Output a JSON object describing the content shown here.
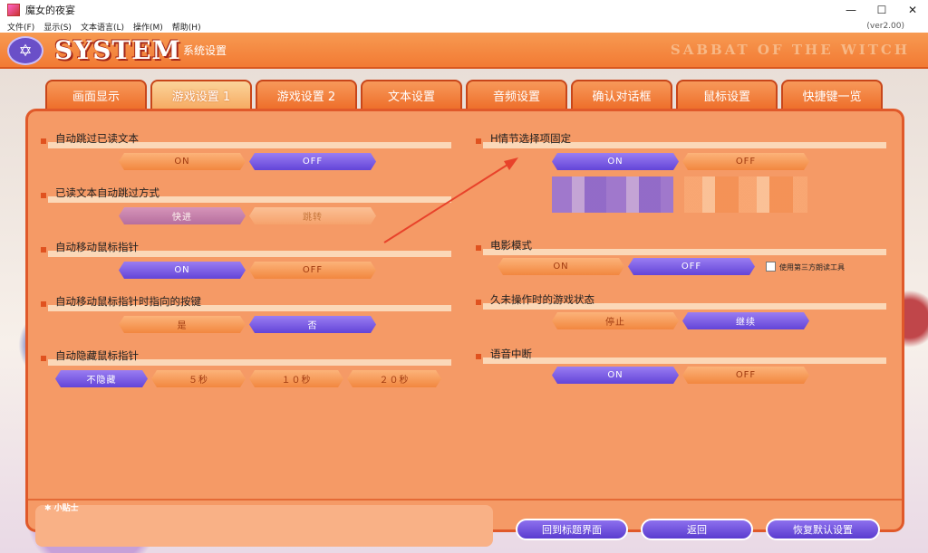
{
  "window": {
    "title": "魔女的夜宴",
    "minimize": "—",
    "maximize": "☐",
    "close": "✕"
  },
  "menu": {
    "items": [
      "文件(F)",
      "显示(S)",
      "文本语言(L)",
      "操作(M)",
      "帮助(H)"
    ],
    "version": "(ver2.00)"
  },
  "header": {
    "logo": "SYSTEM",
    "subtitle": "系统设置",
    "brand": "SABBAT OF THE WITCH"
  },
  "tabs": [
    "画面显示",
    "游戏设置 1",
    "游戏设置 2",
    "文本设置",
    "音频设置",
    "确认对话框",
    "鼠标设置",
    "快捷键一览"
  ],
  "active_tab": "游戏设置 1",
  "left": {
    "s1": {
      "label": "自动跳过已读文本",
      "a": "ON",
      "b": "OFF"
    },
    "s2": {
      "label": "已读文本自动跳过方式",
      "a": "快进",
      "b": "跳转"
    },
    "s3": {
      "label": "自动移动鼠标指针",
      "a": "ON",
      "b": "OFF"
    },
    "s4": {
      "label": "自动移动鼠标指针时指向的按键",
      "a": "是",
      "b": "否"
    },
    "s5": {
      "label": "自动隐藏鼠标指针",
      "a": "不隐藏",
      "b": "５秒",
      "c": "１０秒",
      "d": "２０秒"
    }
  },
  "right": {
    "s1": {
      "label": "H情节选择项固定",
      "a": "ON",
      "b": "OFF"
    },
    "s2": {
      "label": "电影模式",
      "a": "ON",
      "b": "OFF",
      "checkbox": "使用第三方朗读工具"
    },
    "s3": {
      "label": "久未操作时的游戏状态",
      "a": "停止",
      "b": "继续"
    },
    "s4": {
      "label": "语音中断",
      "a": "ON",
      "b": "OFF"
    }
  },
  "footer": {
    "tips_label": "✱ 小贴士",
    "back_title": "回到标题界面",
    "back": "返回",
    "reset": "恢复默认设置"
  },
  "colors": {
    "accent": "#6344d8",
    "panel": "#f59a66",
    "header": "#f27a33"
  }
}
